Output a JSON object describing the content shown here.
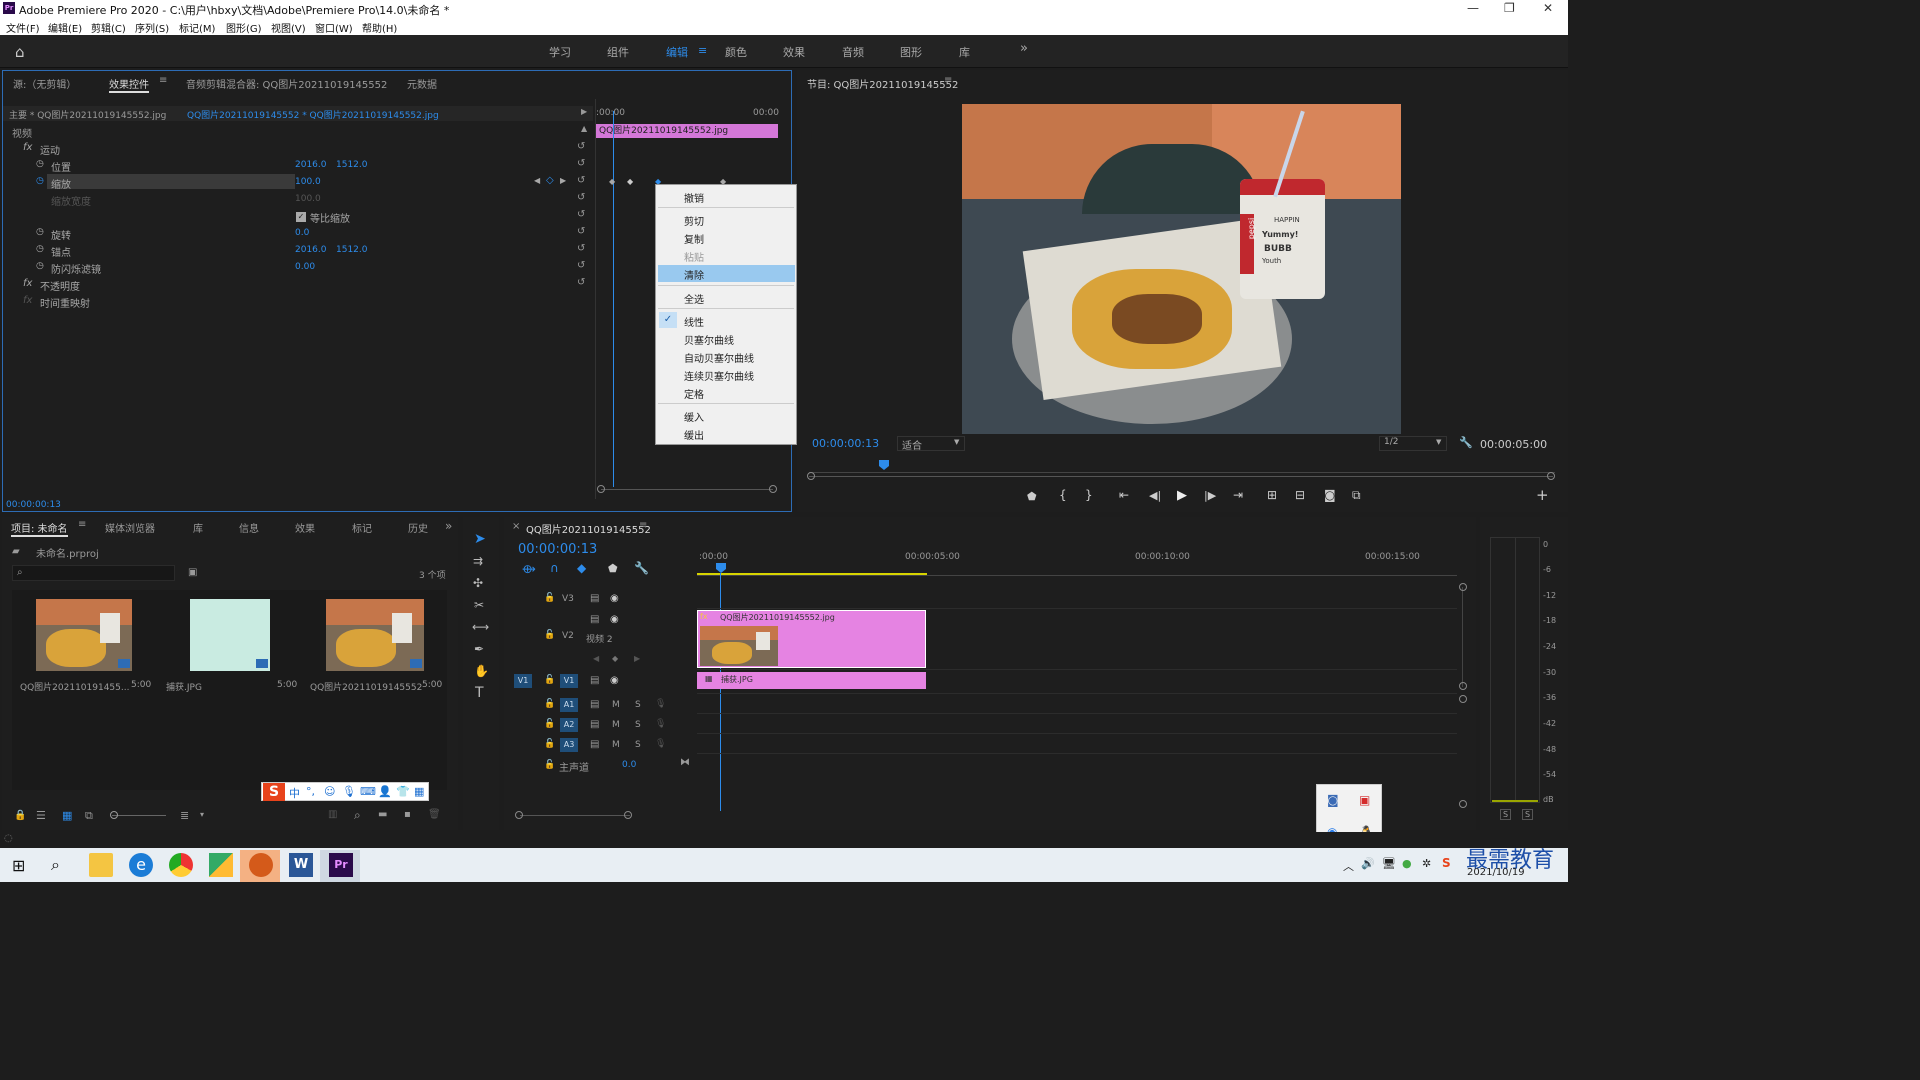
{
  "window": {
    "title": "Adobe Premiere Pro 2020 - C:\\用户\\hbxy\\文档\\Adobe\\Premiere Pro\\14.0\\未命名 *",
    "pr_logo": "Pr"
  },
  "menu": [
    "文件(F)",
    "编辑(E)",
    "剪辑(C)",
    "序列(S)",
    "标记(M)",
    "图形(G)",
    "视图(V)",
    "窗口(W)",
    "帮助(H)"
  ],
  "workspaces": [
    "学习",
    "组件",
    "编辑",
    "颜色",
    "效果",
    "音频",
    "图形",
    "库"
  ],
  "workspace_active": "编辑",
  "source_panel": {
    "tabs": [
      "源:（无剪辑）",
      "效果控件",
      "音频剪辑混合器: QQ图片20211019145552",
      "元数据"
    ],
    "master": "主要 * QQ图片20211019145552.jpg",
    "clip": "QQ图片20211019145552 * QQ图片20211019145552.jpg",
    "tc_start": ":00:00",
    "tc_end": "00:00",
    "clip_bar": "QQ图片20211019145552.jpg",
    "section_video": "视频",
    "motion": "运动",
    "props": [
      {
        "name": "位置",
        "v1": "2016.0",
        "v2": "1512.0"
      },
      {
        "name": "缩放",
        "v1": "100.0",
        "v2": ""
      },
      {
        "name": "缩放宽度",
        "v1": "100.0",
        "v2": ""
      },
      {
        "name": "等比缩放",
        "v1": "",
        "v2": ""
      },
      {
        "name": "旋转",
        "v1": "0.0",
        "v2": ""
      },
      {
        "name": "锚点",
        "v1": "2016.0",
        "v2": "1512.0"
      },
      {
        "name": "防闪烁滤镜",
        "v1": "0.00",
        "v2": ""
      }
    ],
    "opacity": "不透明度",
    "time_remap": "时间重映射",
    "timecode": "00:00:00:13",
    "fx_label": "fx"
  },
  "context_menu": {
    "items": [
      "撤销",
      "剪切",
      "复制",
      "粘贴",
      "清除",
      "全选",
      "线性",
      "贝塞尔曲线",
      "自动贝塞尔曲线",
      "连续贝塞尔曲线",
      "定格",
      "缓入",
      "缓出"
    ],
    "highlighted": "清除",
    "checked": "线性",
    "disabled": "粘贴"
  },
  "program": {
    "title": "节目: QQ图片20211019145552",
    "timecode": "00:00:00:13",
    "fit": "适合",
    "quality": "1/2",
    "duration": "00:00:05:00",
    "cup_text": [
      "pepsi",
      "HAPPIN",
      "Yummy!",
      "BUBB",
      "Youth"
    ]
  },
  "project": {
    "tabs": [
      "项目: 未命名",
      "媒体浏览器",
      "库",
      "信息",
      "效果",
      "标记",
      "历史"
    ],
    "file": "未命名.prproj",
    "count": "3 个项",
    "items": [
      {
        "name": "QQ图片202110191455...",
        "dur": "5:00"
      },
      {
        "name": "捕获.JPG",
        "dur": "5:00"
      },
      {
        "name": "QQ图片20211019145552",
        "dur": "5:00"
      }
    ]
  },
  "timeline": {
    "title": "QQ图片20211019145552",
    "timecode": "00:00:00:13",
    "ruler": [
      ":00:00",
      "00:00:05:00",
      "00:00:10:00",
      "00:00:15:00"
    ],
    "tracks": [
      "V3",
      "V2",
      "V1",
      "A1",
      "A2",
      "A3"
    ],
    "v2_name": "视频 2",
    "master": "主声道",
    "master_val": "0.0",
    "clip1": "QQ图片20211019145552.jpg",
    "clip2": "捕获.JPG",
    "ms": [
      "M",
      "S"
    ]
  },
  "meter": {
    "labels": [
      "0",
      "-6",
      "-12",
      "-18",
      "-24",
      "-30",
      "-36",
      "-42",
      "-48",
      "-54",
      "dB"
    ],
    "solo": [
      "S",
      "S"
    ]
  },
  "ime": {
    "label": "中"
  },
  "taskbar": {
    "date": "2021/10/19",
    "watermark": "最需教育"
  }
}
